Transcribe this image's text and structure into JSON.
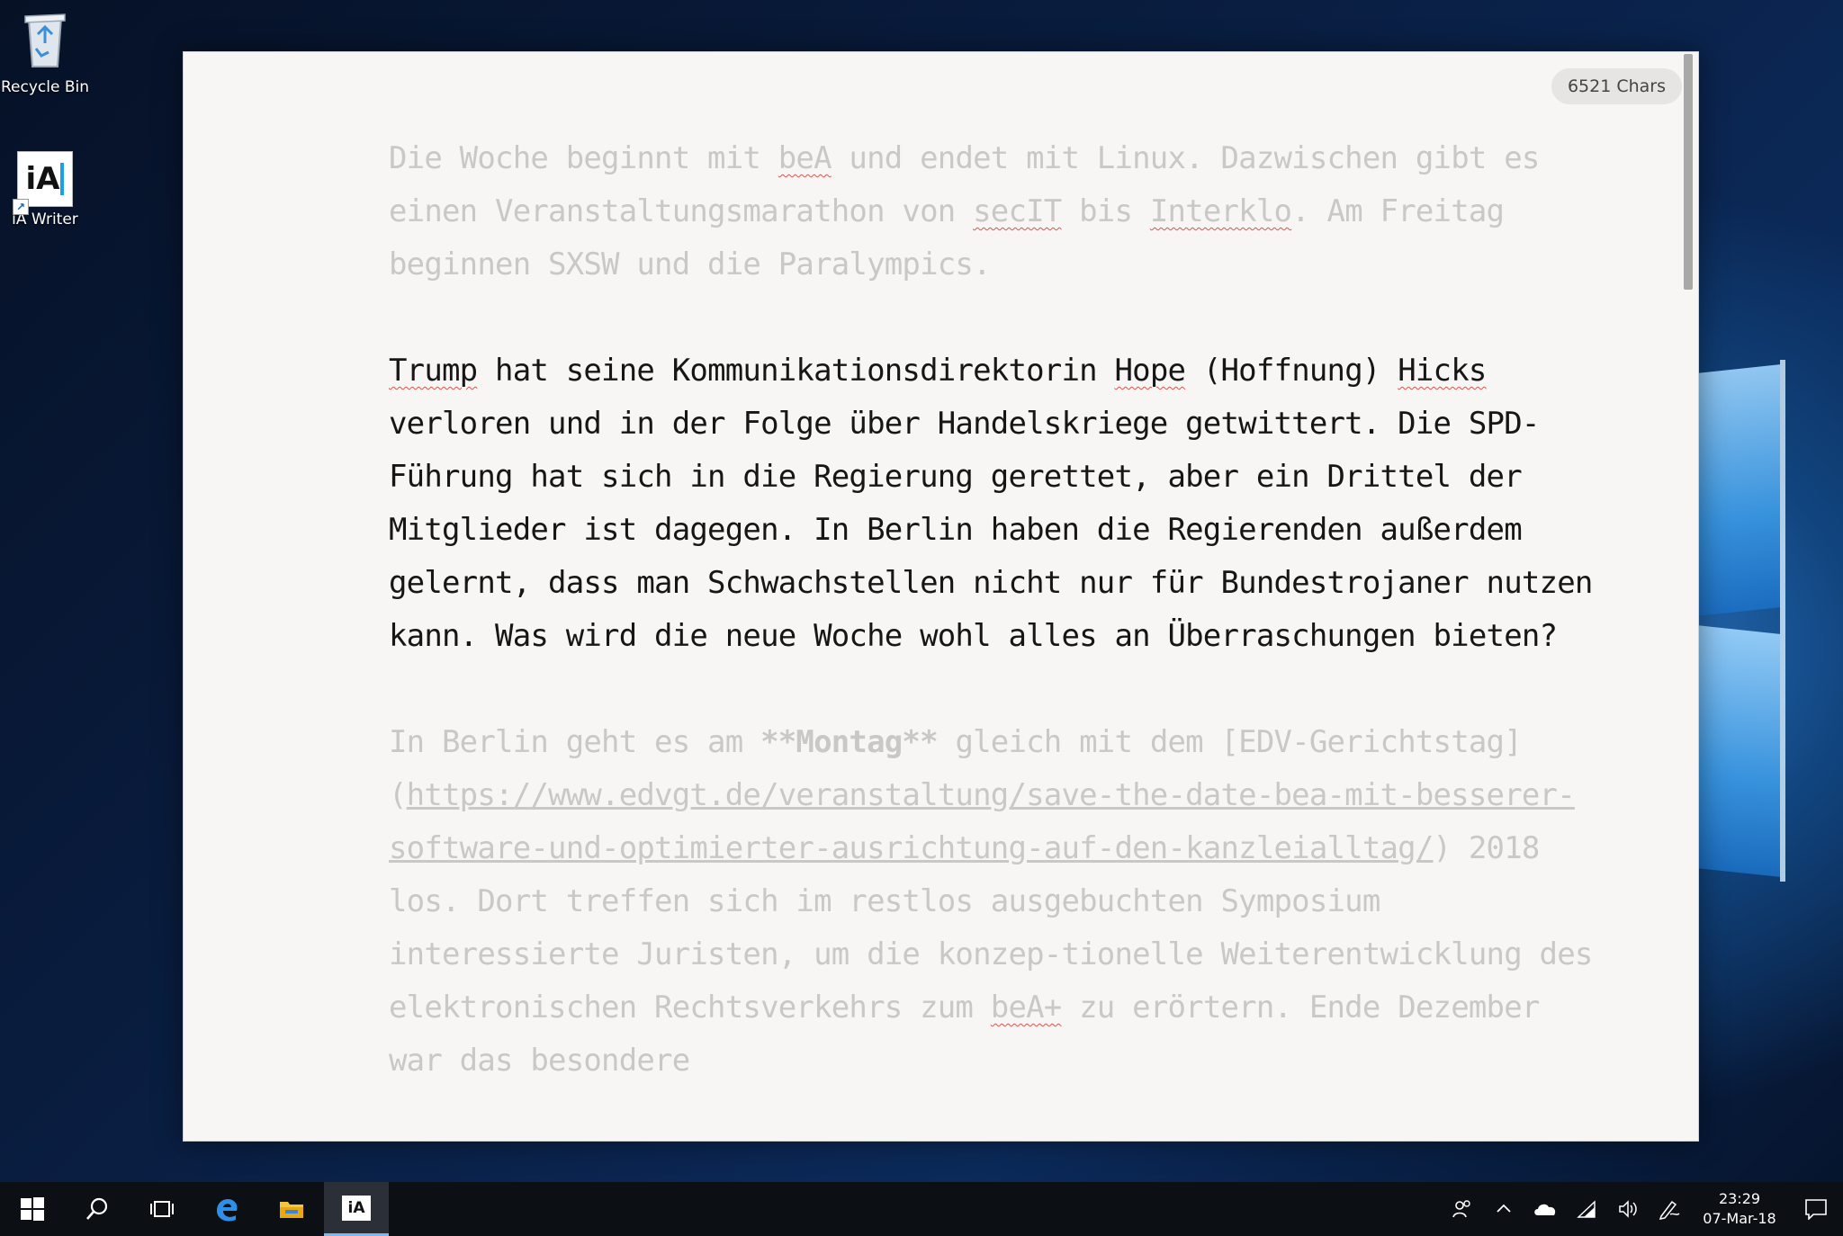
{
  "desktop": {
    "icons": [
      {
        "label": "Recycle Bin",
        "icon": "recycle-bin-icon"
      },
      {
        "label": "iA Writer",
        "icon": "ia-writer-icon",
        "glyph": "iA"
      }
    ]
  },
  "editor": {
    "char_count": "6521 Chars",
    "paragraphs": {
      "p1": {
        "a": "Die Woche beginnt mit ",
        "b": "beA",
        "c": " und endet mit Linux. Dazwischen gibt es einen Veranstaltungsmarathon von ",
        "d": "secIT",
        "e": " bis ",
        "f": "Interklo",
        "g": ". Am Freitag beginnen SXSW und die Paralympics."
      },
      "p2": {
        "a": "Trump",
        "b": " hat seine Kommunikationsdirektorin ",
        "c": "Hope",
        "d": " (Hoffnung) ",
        "e": "Hicks",
        "f": " verloren und in der Folge über Handelskriege getwittert. Die SPD-Führung hat sich in die Regierung gerettet, aber ein Drittel der Mitglieder ist dagegen. In Berlin haben die Regierenden außerdem gelernt, dass man Schwachstellen nicht nur für Bundestrojaner nutzen kann. Was wird die neue Woche wohl alles an Überraschungen bieten?"
      },
      "p3": {
        "a": "In Berlin geht es am ",
        "b": "**Montag**",
        "c": " gleich mit dem [EDV-Gerichtstag](",
        "d": "https://www.edvgt.de/veranstaltung/save-the-date-bea-mit-besserer-software-und-optimierter-ausrichtung-auf-den-kanzleialltag/",
        "e": ") 2018 los. Dort treffen sich im restlos ausgebuchten Symposium interessierte Juristen, um die konzep-tionelle Weiterentwicklung des elektronischen Rechtsverkehrs zum ",
        "f": "beA+",
        "g": " zu erörtern. Ende Dezember war das besondere"
      }
    }
  },
  "taskbar": {
    "apps": [
      "start-icon",
      "search-icon",
      "task-view-icon",
      "edge-icon",
      "file-explorer-icon",
      "ia-writer-icon"
    ],
    "active_app_glyph": "iA",
    "clock": {
      "time": "23:29",
      "date": "07-Mar-18"
    }
  }
}
